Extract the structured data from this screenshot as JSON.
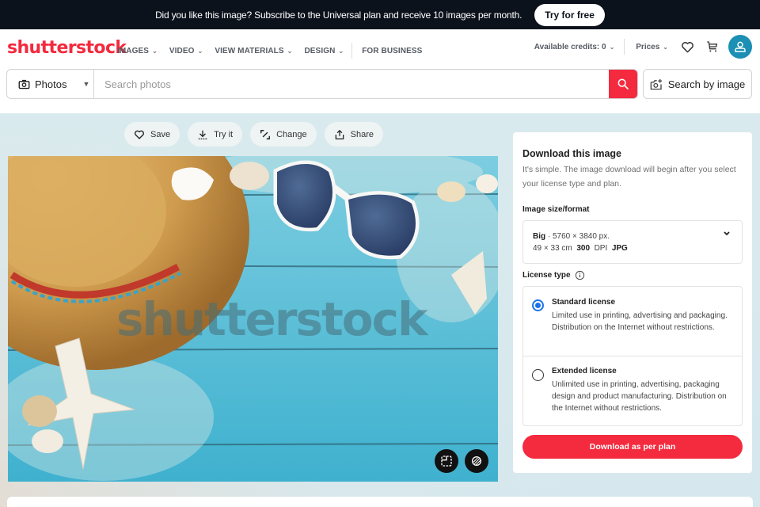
{
  "promo": {
    "text": "Did you like this image? Subscribe to the Universal plan and receive 10 images per month.",
    "button": "Try for free"
  },
  "header": {
    "logo": "shutterstock",
    "nav": [
      {
        "label": "IMAGES",
        "dropdown": true
      },
      {
        "label": "VIDEO",
        "dropdown": true
      },
      {
        "label": "VIEW MATERIALS",
        "dropdown": true
      },
      {
        "label": "DESIGN",
        "dropdown": true
      },
      {
        "label": "FOR BUSINESS",
        "dropdown": false
      }
    ],
    "credits": "Available credits: 0",
    "prices": "Prices",
    "icons": [
      "heart-icon",
      "cart-icon",
      "user-icon"
    ]
  },
  "search": {
    "type": "Photos",
    "placeholder": "Search photos",
    "value": "",
    "by_image": "Search by image"
  },
  "actions": [
    {
      "label": "Save",
      "icon": "heart-icon"
    },
    {
      "label": "Try it",
      "icon": "download-icon"
    },
    {
      "label": "Change",
      "icon": "edit-icon"
    },
    {
      "label": "Share",
      "icon": "share-icon"
    }
  ],
  "image": {
    "watermark": "shutterstock",
    "description": "Straw hat, sunglasses, starfish and seashells on blue wooden planks with sand"
  },
  "panel": {
    "title": "Download this image",
    "subtitle": "It's simple. The image download will begin after you select your license type and plan.",
    "size_label": "Image size/format",
    "size": {
      "name": "Big",
      "pixels": "· 5760 × 3840 px.",
      "cm": "49 × 33 cm",
      "dpi_value": "300",
      "dpi_label": "DPI",
      "format": "JPG"
    },
    "license_label": "License type",
    "licenses": [
      {
        "title": "Standard license",
        "desc": "Limited use in printing, advertising and packaging. Distribution on the Internet without restrictions.",
        "selected": true
      },
      {
        "title": "Extended license",
        "desc": "Unlimited use in printing, advertising, packaging design and product manufacturing. Distribution on the Internet without restrictions.",
        "selected": false
      }
    ],
    "download_button": "Download as per plan"
  },
  "colors": {
    "brand": "#f42a3e",
    "promo_bg": "#0c121c",
    "avatar": "#1b8fb4",
    "radio_selected": "#1a73e8"
  }
}
